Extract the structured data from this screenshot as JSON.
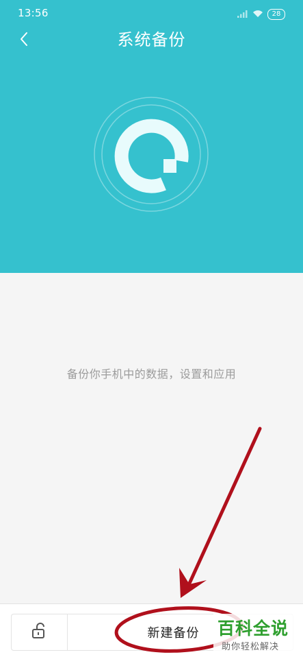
{
  "status_bar": {
    "time": "13:56",
    "battery": "28",
    "icons": [
      "signal-icon",
      "wifi-icon",
      "battery-icon"
    ]
  },
  "header": {
    "title": "系统备份",
    "back_icon": "chevron-left-icon",
    "logo_icon": "backup-refresh-icon",
    "background_color": "#35c1ce"
  },
  "main": {
    "description": "备份你手机中的数据，设置和应用"
  },
  "bottom_bar": {
    "lock_icon": "unlock-icon",
    "new_backup_label": "新建备份"
  },
  "annotation": {
    "color": "#b0101c",
    "shapes": [
      "ellipse-highlight",
      "arrow"
    ]
  },
  "watermark": {
    "title": "百科全说",
    "subtitle": "助你轻松解决"
  }
}
